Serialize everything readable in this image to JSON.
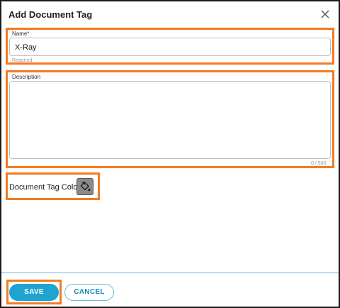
{
  "dialog": {
    "title": "Add Document Tag",
    "close_icon": "close-icon"
  },
  "name_field": {
    "label": "Name*",
    "value": "X-Ray",
    "hint": "Required"
  },
  "description_field": {
    "label": "Description",
    "value": "",
    "counter": "0 / 500"
  },
  "color_picker": {
    "label": "Document Tag Color",
    "icon": "paint-bucket-icon",
    "swatch_color": "#8a8a8a"
  },
  "footer": {
    "save_label": "SAVE",
    "cancel_label": "CANCEL"
  },
  "colors": {
    "highlight": "#f47a20",
    "accent": "#1ea4cf",
    "divider": "#6fb6dc"
  }
}
